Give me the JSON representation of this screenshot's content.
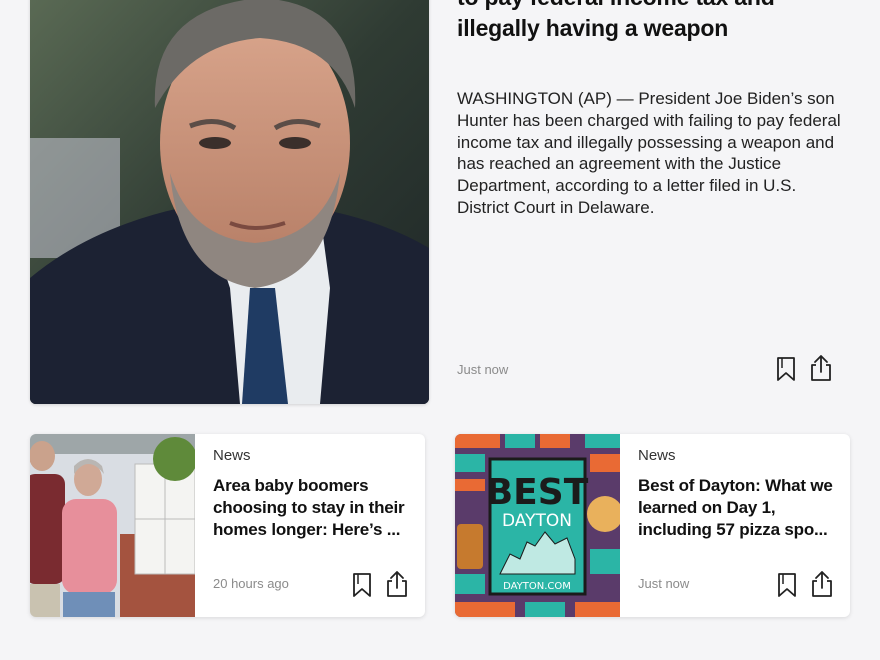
{
  "hero": {
    "headline": "to pay federal income tax and illegally having a weapon",
    "summary": "WASHINGTON (AP) — President Joe Biden’s son Hunter has been charged with failing to pay federal income tax and illegally possessing a weapon and has reached an agreement with the Justice Department, according to a letter filed in U.S. District Court in Delaware.",
    "timestamp": "Just now",
    "bookmark_icon": "bookmark-icon",
    "share_icon": "share-icon"
  },
  "cards": [
    {
      "category": "News",
      "title": "Area baby boomers choosing to stay in their homes longer: Here’s ...",
      "timestamp": "20 hours ago"
    },
    {
      "category": "News",
      "title": "Best of Dayton: What we learned on Day 1, including 57 pizza spo...",
      "timestamp": "Just now",
      "thumb_text": {
        "best": "BEST",
        "dayton": "DAYTON",
        "site": "DAYTON.COM"
      }
    }
  ],
  "colors": {
    "background": "#f5f5f7",
    "timestamp": "#8b8b8b",
    "teal": "#2bb5a6",
    "orange": "#e96a34",
    "purple": "#5a3b6a"
  }
}
